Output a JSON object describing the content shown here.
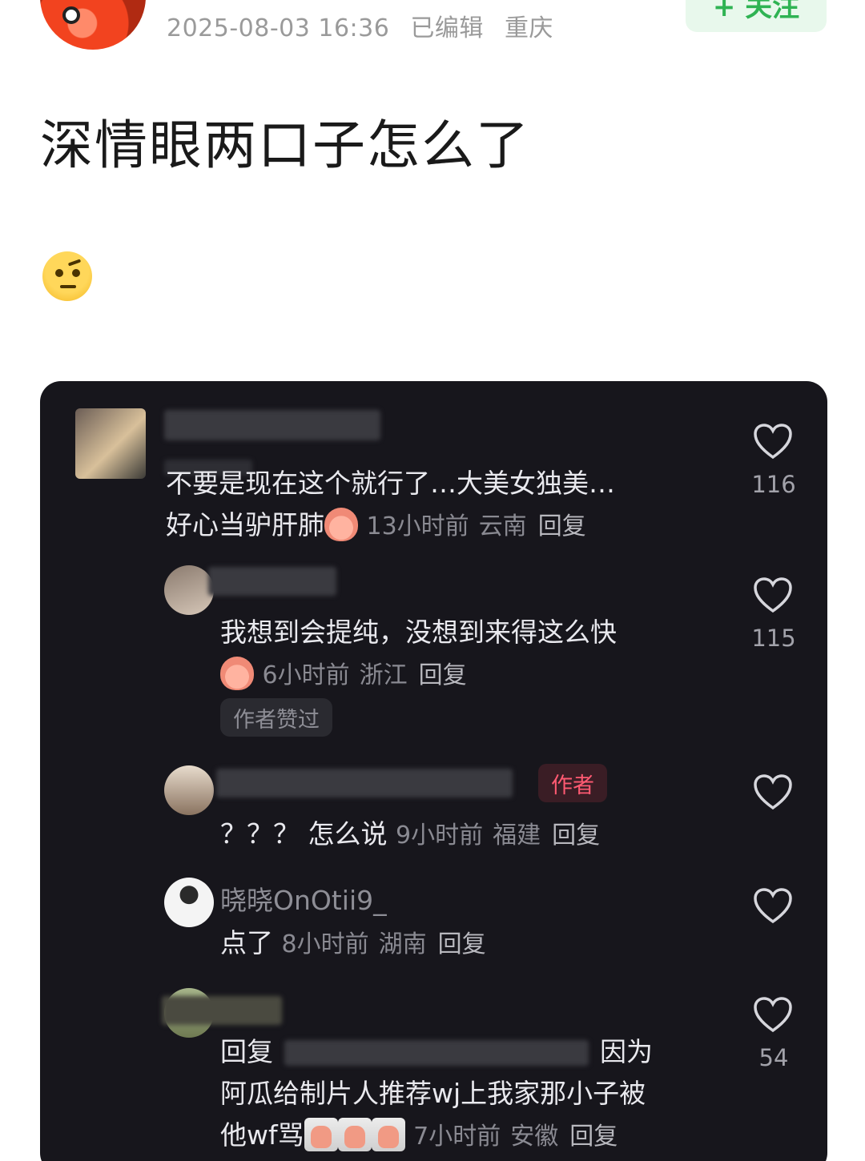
{
  "post": {
    "timestamp": "2025-08-03 16:36",
    "edited_label": "已编辑",
    "location": "重庆",
    "follow_label": "+ 关注",
    "title": "深情眼两口子怎么了",
    "emoji_icon": "raised-eyebrow-emoji"
  },
  "comments": [
    {
      "name": "",
      "text_lines": [
        "不要是现在这个就行了…大美女独美…",
        "好心当驴肝肺"
      ],
      "sticker": "pink-blush-sticker",
      "time": "13小时前",
      "location": "云南",
      "reply_label": "回复",
      "likes": "116"
    },
    {
      "name": "",
      "text_lines": [
        "我想到会提纯，没想到来得这么快"
      ],
      "sticker": "crying-pink-sticker",
      "time": "6小时前",
      "location": "浙江",
      "reply_label": "回复",
      "likes": "115",
      "badge": "作者赞过"
    },
    {
      "name": "",
      "author_badge": "作者",
      "text_lines": [
        "？？？ 怎么说"
      ],
      "time": "9小时前",
      "location": "福建",
      "reply_label": "回复",
      "likes": ""
    },
    {
      "name": "晓晓OnOtii9_",
      "text_lines": [
        "点了"
      ],
      "time": "8小时前",
      "location": "湖南",
      "reply_label": "回复",
      "likes": ""
    },
    {
      "name": "",
      "text_lines": [
        "回复",
        "因为",
        "阿瓜给制片人推荐wj上我家那小子被",
        "他wf骂"
      ],
      "sticker": "grumpy-face-sticker",
      "time": "7小时前",
      "location": "安徽",
      "reply_label": "回复",
      "likes": "54"
    }
  ],
  "colors": {
    "panel_bg": "#17161c",
    "follow_green": "#2fb353",
    "author_red": "#ff5a72"
  }
}
